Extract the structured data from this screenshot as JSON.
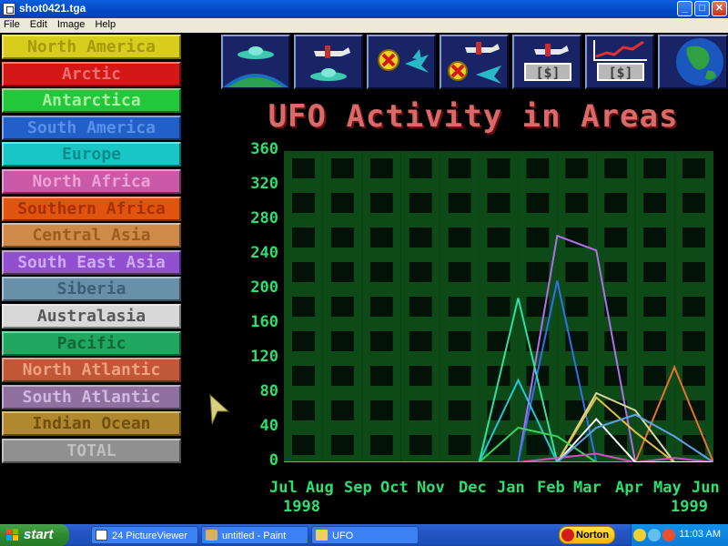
{
  "window": {
    "title": "shot0421.tga",
    "minimize_glyph": "_",
    "maximize_glyph": "□",
    "close_glyph": "✕"
  },
  "menu": [
    "File",
    "Edit",
    "Image",
    "Help"
  ],
  "regions": [
    {
      "label": "North America",
      "bg": "#d8cc1c",
      "fg": "#a8980a"
    },
    {
      "label": "Arctic",
      "bg": "#d41818",
      "fg": "#f07070"
    },
    {
      "label": "Antarctica",
      "bg": "#22c83c",
      "fg": "#aaf0a0"
    },
    {
      "label": "South America",
      "bg": "#2060c8",
      "fg": "#5a90e8"
    },
    {
      "label": "Europe",
      "bg": "#18c6c6",
      "fg": "#0a8c8c"
    },
    {
      "label": "North Africa",
      "bg": "#c85aa8",
      "fg": "#f0a0d8"
    },
    {
      "label": "Southern Africa",
      "bg": "#e05410",
      "fg": "#a83000"
    },
    {
      "label": "Central Asia",
      "bg": "#d08a4a",
      "fg": "#a05c20"
    },
    {
      "label": "South East Asia",
      "bg": "#9050d0",
      "fg": "#d0a8f8"
    },
    {
      "label": "Siberia",
      "bg": "#6890a8",
      "fg": "#3a6078"
    },
    {
      "label": "Australasia",
      "bg": "#d8d8d8",
      "fg": "#585858"
    },
    {
      "label": "Pacific",
      "bg": "#20a860",
      "fg": "#106a38"
    },
    {
      "label": "North Atlantic",
      "bg": "#c05838",
      "fg": "#f0a080"
    },
    {
      "label": "South Atlantic",
      "bg": "#9070a0",
      "fg": "#d0b8e0"
    },
    {
      "label": "Indian Ocean",
      "bg": "#b08830",
      "fg": "#705010"
    },
    {
      "label": "TOTAL",
      "bg": "#909090",
      "fg": "#c0c0c0"
    }
  ],
  "toolbar_buttons": [
    {
      "name": "ufo-activity-areas-button",
      "icon": "ufo-over-earth-icon"
    },
    {
      "name": "ufo-activity-countries-button",
      "icon": "ufo-and-plane-icon"
    },
    {
      "name": "xcom-activity-areas-button",
      "icon": "crossed-out-craft-icon"
    },
    {
      "name": "xcom-activity-countries-button",
      "icon": "plane-crossed-out-icon"
    },
    {
      "name": "income-button",
      "icon": "plane-money-icon"
    },
    {
      "name": "finance-button",
      "icon": "money-graph-icon"
    },
    {
      "name": "geoscape-button",
      "icon": "globe-icon"
    }
  ],
  "chart_data": {
    "type": "line",
    "title": "UFO Activity in Areas",
    "x_ticks": [
      "Jul",
      "Aug",
      "Sep",
      "Oct",
      "Nov",
      "Dec",
      "Jan",
      "Feb",
      "Mar",
      "Apr",
      "May",
      "Jun"
    ],
    "x_years": [
      "1998",
      "1999"
    ],
    "y_ticks": [
      "0",
      "40",
      "80",
      "120",
      "160",
      "200",
      "240",
      "280",
      "320",
      "360"
    ],
    "ylim": [
      0,
      360
    ],
    "grid": true,
    "series": [
      {
        "color": "#b070e8",
        "values": [
          0,
          0,
          0,
          0,
          0,
          0,
          0,
          262,
          245,
          0,
          0,
          0
        ]
      },
      {
        "color": "#3070e8",
        "values": [
          0,
          0,
          0,
          0,
          0,
          0,
          0,
          210,
          0,
          0,
          0,
          0
        ]
      },
      {
        "color": "#30e0a0",
        "values": [
          0,
          0,
          0,
          0,
          0,
          0,
          190,
          0,
          0,
          0,
          0,
          0
        ]
      },
      {
        "color": "#e87030",
        "values": [
          0,
          0,
          0,
          0,
          0,
          0,
          0,
          0,
          0,
          0,
          110,
          0
        ]
      },
      {
        "color": "#20c8d8",
        "values": [
          0,
          0,
          0,
          0,
          0,
          0,
          95,
          0,
          0,
          0,
          0,
          0
        ]
      },
      {
        "color": "#d8d8a0",
        "values": [
          0,
          0,
          0,
          0,
          0,
          0,
          0,
          0,
          80,
          60,
          0,
          0
        ]
      },
      {
        "color": "#e8c040",
        "values": [
          0,
          0,
          0,
          0,
          0,
          0,
          0,
          0,
          75,
          35,
          0,
          0
        ]
      },
      {
        "color": "#40d060",
        "values": [
          0,
          0,
          0,
          0,
          0,
          0,
          40,
          30,
          0,
          0,
          0,
          0
        ]
      },
      {
        "color": "#d050c0",
        "values": [
          0,
          0,
          0,
          0,
          0,
          0,
          0,
          5,
          10,
          0,
          5,
          0
        ]
      },
      {
        "color": "#ffffff",
        "values": [
          0,
          0,
          0,
          0,
          0,
          0,
          0,
          0,
          50,
          0,
          0,
          0
        ]
      },
      {
        "color": "#60a0e8",
        "values": [
          0,
          0,
          0,
          0,
          0,
          0,
          0,
          0,
          40,
          55,
          30,
          0
        ]
      }
    ]
  },
  "taskbar": {
    "start_label": "start",
    "items": [
      {
        "label": "24 PictureViewer",
        "icon": "picture-viewer-icon"
      },
      {
        "label": "untitled - Paint",
        "icon": "paint-icon"
      },
      {
        "label": "UFO",
        "icon": "folder-icon"
      }
    ],
    "norton_label": "Norton",
    "clock": "11:03 AM"
  }
}
